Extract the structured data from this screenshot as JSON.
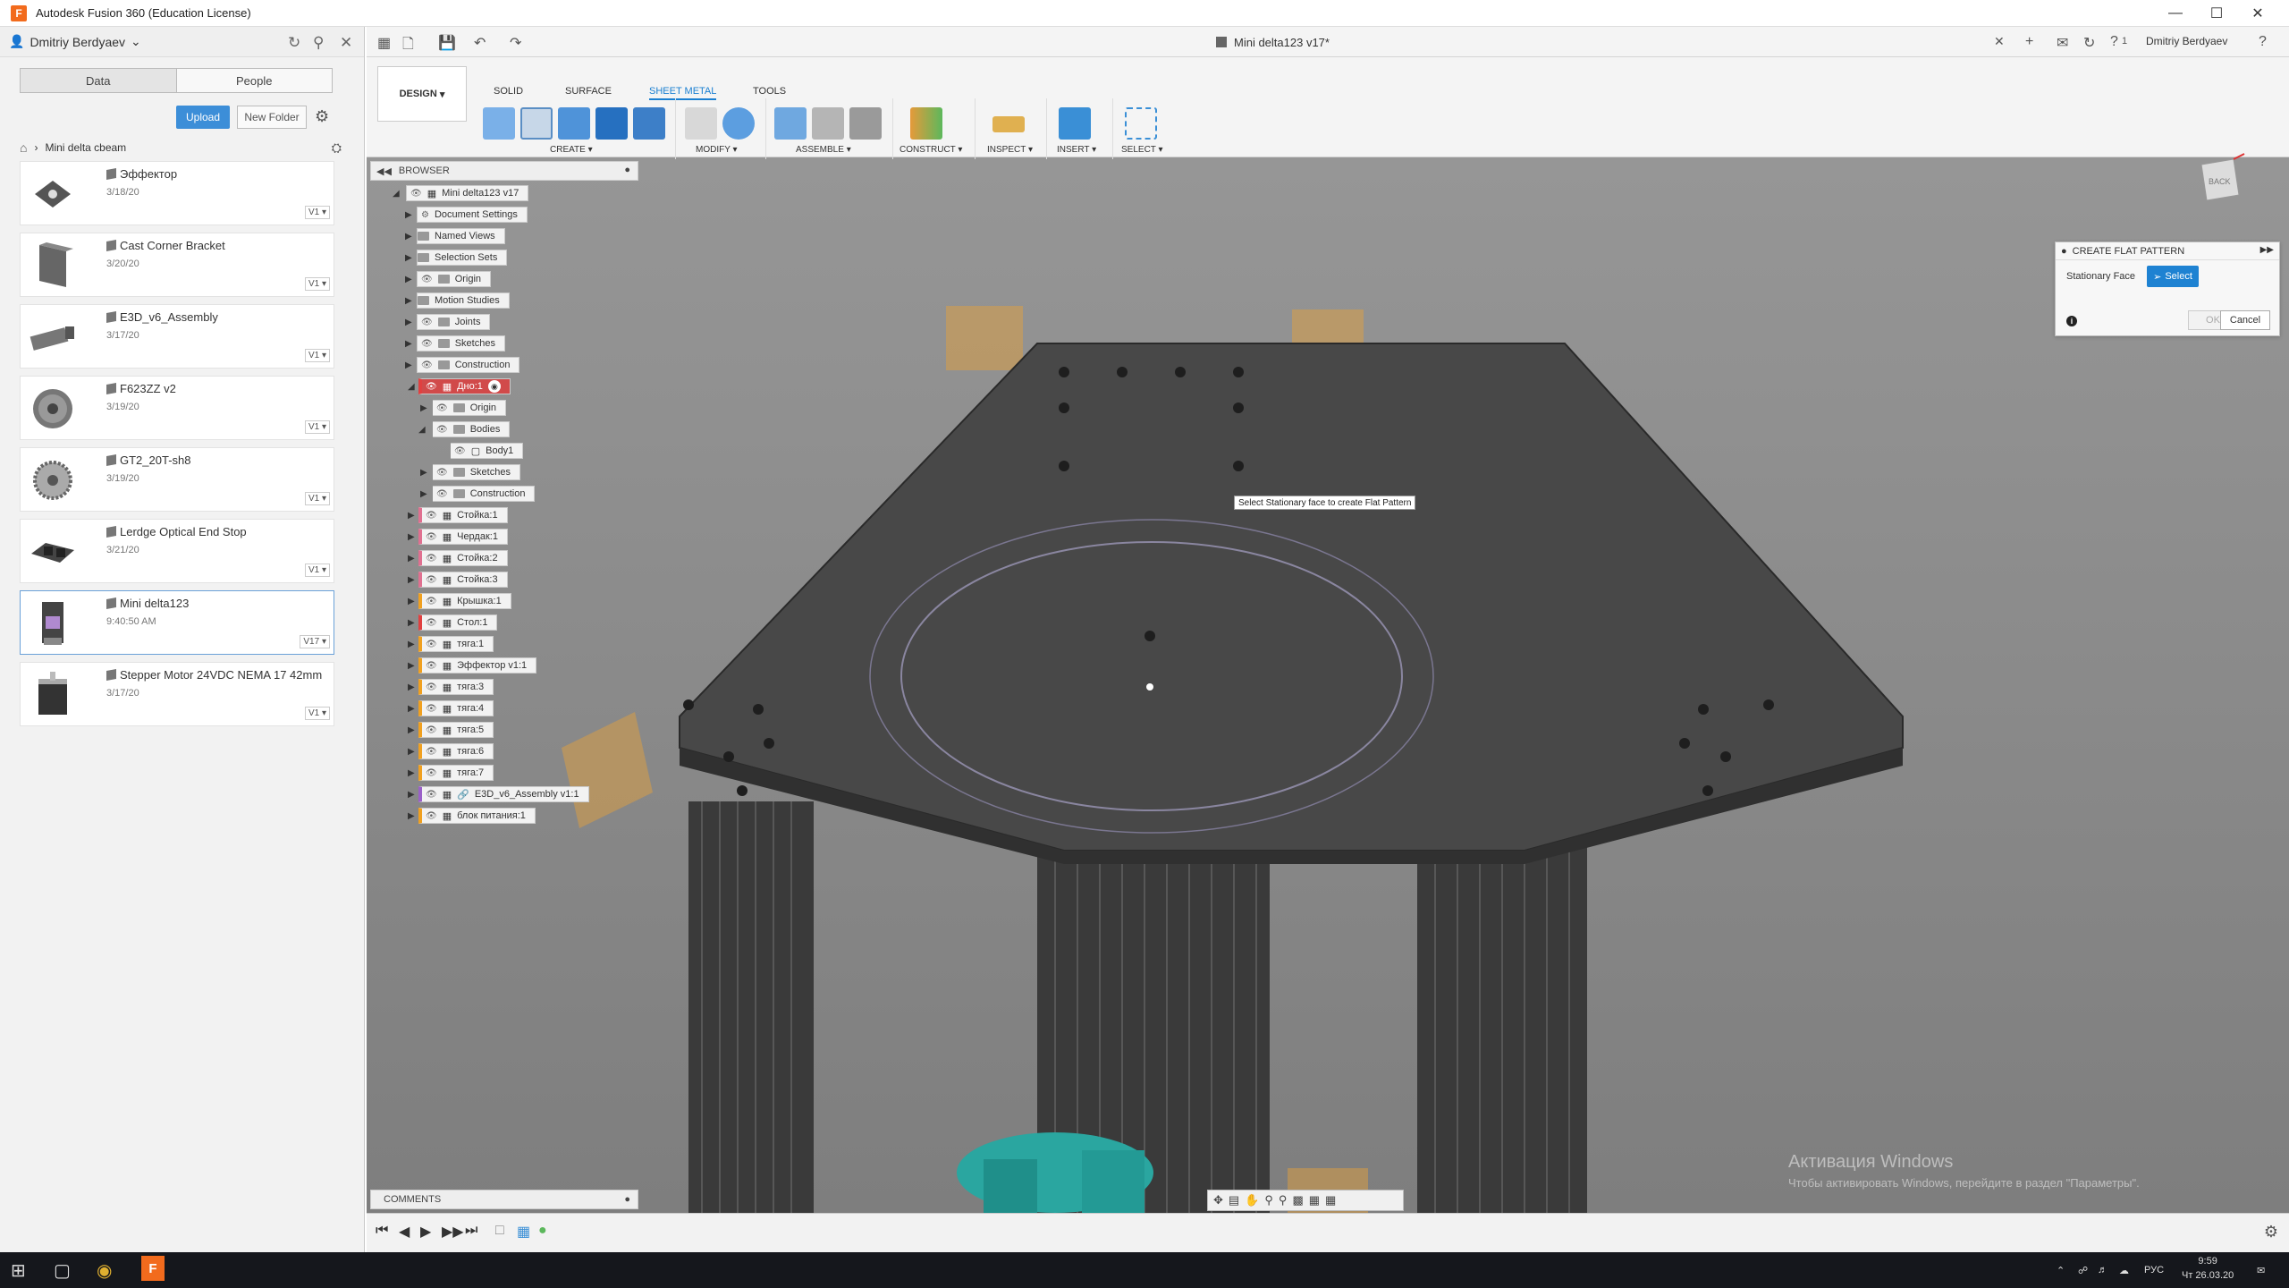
{
  "window": {
    "title": "Autodesk Fusion 360 (Education License)"
  },
  "left_panel": {
    "user": "Dmitriy Berdyaev",
    "tabs": [
      "Data",
      "People"
    ],
    "upload_label": "Upload",
    "new_folder_label": "New Folder",
    "breadcrumb": "Mini delta cbeam",
    "files": [
      {
        "name": "Эффектор",
        "date": "3/18/20",
        "version": "V1"
      },
      {
        "name": "Cast Corner Bracket",
        "date": "3/20/20",
        "version": "V1"
      },
      {
        "name": "E3D_v6_Assembly",
        "date": "3/17/20",
        "version": "V1"
      },
      {
        "name": "F623ZZ v2",
        "date": "3/19/20",
        "version": "V1"
      },
      {
        "name": "GT2_20T-sh8",
        "date": "3/19/20",
        "version": "V1"
      },
      {
        "name": "Lerdge Optical End Stop",
        "date": "3/21/20",
        "version": "V1"
      },
      {
        "name": "Mini delta123",
        "date": "9:40:50 AM",
        "version": "V17"
      },
      {
        "name": "Stepper Motor 24VDC NEMA 17 42mm",
        "date": "3/17/20",
        "version": "V1"
      }
    ]
  },
  "app": {
    "doc_title": "Mini delta123 v17*",
    "user": "Dmitriy Berdyaev",
    "notifications": "1"
  },
  "toolbar": {
    "workspace": "DESIGN",
    "tabs": [
      "SOLID",
      "SURFACE",
      "SHEET METAL",
      "TOOLS"
    ],
    "active_tab": "SHEET METAL",
    "groups": [
      "CREATE",
      "MODIFY",
      "ASSEMBLE",
      "CONSTRUCT",
      "INSPECT",
      "INSERT",
      "SELECT"
    ]
  },
  "browser": {
    "title": "BROWSER",
    "root": "Mini delta123 v17",
    "items": [
      "Document Settings",
      "Named Views",
      "Selection Sets",
      "Origin",
      "Motion Studies",
      "Joints",
      "Sketches",
      "Construction",
      "Дно:1",
      "Origin",
      "Bodies",
      "Body1",
      "Sketches",
      "Construction",
      "Стойка:1",
      "Чердак:1",
      "Стойка:2",
      "Стойка:3",
      "Крышка:1",
      "Стол:1",
      "тяга:1",
      "Эффектор v1:1",
      "тяга:3",
      "тяга:4",
      "тяга:5",
      "тяга:6",
      "тяга:7",
      "E3D_v6_Assembly v1:1",
      "блок питания:1"
    ]
  },
  "dialog": {
    "title": "CREATE FLAT PATTERN",
    "field_label": "Stationary Face",
    "select_label": "Select",
    "ok_label": "OK",
    "cancel_label": "Cancel"
  },
  "viewport": {
    "tooltip": "Select Stationary face to create Flat Pattern",
    "viewcube_label": "BACK"
  },
  "comments": {
    "title": "COMMENTS"
  },
  "watermark": {
    "line1": "Активация Windows",
    "line2": "Чтобы активировать Windows, перейдите в раздел \"Параметры\"."
  },
  "taskbar": {
    "time": "9:59",
    "date": "Чт 26.03.20",
    "lang": "РУС"
  },
  "colors": {
    "accent": "#1e82d2",
    "fusion_brand": "#f26b1d",
    "highlight_row": "#d14a4a"
  }
}
